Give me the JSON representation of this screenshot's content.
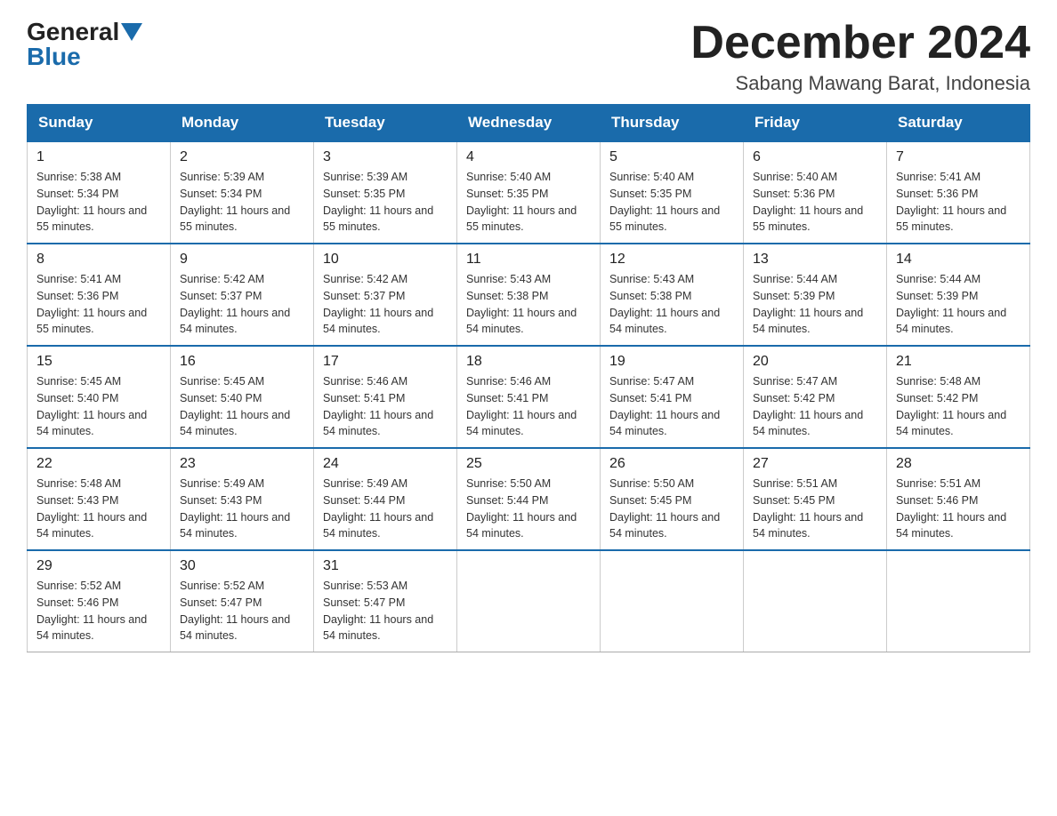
{
  "header": {
    "logo_general": "General",
    "logo_blue": "Blue",
    "month_title": "December 2024",
    "subtitle": "Sabang Mawang Barat, Indonesia"
  },
  "weekdays": [
    "Sunday",
    "Monday",
    "Tuesday",
    "Wednesday",
    "Thursday",
    "Friday",
    "Saturday"
  ],
  "weeks": [
    [
      {
        "day": "1",
        "sunrise": "5:38 AM",
        "sunset": "5:34 PM",
        "daylight": "11 hours and 55 minutes."
      },
      {
        "day": "2",
        "sunrise": "5:39 AM",
        "sunset": "5:34 PM",
        "daylight": "11 hours and 55 minutes."
      },
      {
        "day": "3",
        "sunrise": "5:39 AM",
        "sunset": "5:35 PM",
        "daylight": "11 hours and 55 minutes."
      },
      {
        "day": "4",
        "sunrise": "5:40 AM",
        "sunset": "5:35 PM",
        "daylight": "11 hours and 55 minutes."
      },
      {
        "day": "5",
        "sunrise": "5:40 AM",
        "sunset": "5:35 PM",
        "daylight": "11 hours and 55 minutes."
      },
      {
        "day": "6",
        "sunrise": "5:40 AM",
        "sunset": "5:36 PM",
        "daylight": "11 hours and 55 minutes."
      },
      {
        "day": "7",
        "sunrise": "5:41 AM",
        "sunset": "5:36 PM",
        "daylight": "11 hours and 55 minutes."
      }
    ],
    [
      {
        "day": "8",
        "sunrise": "5:41 AM",
        "sunset": "5:36 PM",
        "daylight": "11 hours and 55 minutes."
      },
      {
        "day": "9",
        "sunrise": "5:42 AM",
        "sunset": "5:37 PM",
        "daylight": "11 hours and 54 minutes."
      },
      {
        "day": "10",
        "sunrise": "5:42 AM",
        "sunset": "5:37 PM",
        "daylight": "11 hours and 54 minutes."
      },
      {
        "day": "11",
        "sunrise": "5:43 AM",
        "sunset": "5:38 PM",
        "daylight": "11 hours and 54 minutes."
      },
      {
        "day": "12",
        "sunrise": "5:43 AM",
        "sunset": "5:38 PM",
        "daylight": "11 hours and 54 minutes."
      },
      {
        "day": "13",
        "sunrise": "5:44 AM",
        "sunset": "5:39 PM",
        "daylight": "11 hours and 54 minutes."
      },
      {
        "day": "14",
        "sunrise": "5:44 AM",
        "sunset": "5:39 PM",
        "daylight": "11 hours and 54 minutes."
      }
    ],
    [
      {
        "day": "15",
        "sunrise": "5:45 AM",
        "sunset": "5:40 PM",
        "daylight": "11 hours and 54 minutes."
      },
      {
        "day": "16",
        "sunrise": "5:45 AM",
        "sunset": "5:40 PM",
        "daylight": "11 hours and 54 minutes."
      },
      {
        "day": "17",
        "sunrise": "5:46 AM",
        "sunset": "5:41 PM",
        "daylight": "11 hours and 54 minutes."
      },
      {
        "day": "18",
        "sunrise": "5:46 AM",
        "sunset": "5:41 PM",
        "daylight": "11 hours and 54 minutes."
      },
      {
        "day": "19",
        "sunrise": "5:47 AM",
        "sunset": "5:41 PM",
        "daylight": "11 hours and 54 minutes."
      },
      {
        "day": "20",
        "sunrise": "5:47 AM",
        "sunset": "5:42 PM",
        "daylight": "11 hours and 54 minutes."
      },
      {
        "day": "21",
        "sunrise": "5:48 AM",
        "sunset": "5:42 PM",
        "daylight": "11 hours and 54 minutes."
      }
    ],
    [
      {
        "day": "22",
        "sunrise": "5:48 AM",
        "sunset": "5:43 PM",
        "daylight": "11 hours and 54 minutes."
      },
      {
        "day": "23",
        "sunrise": "5:49 AM",
        "sunset": "5:43 PM",
        "daylight": "11 hours and 54 minutes."
      },
      {
        "day": "24",
        "sunrise": "5:49 AM",
        "sunset": "5:44 PM",
        "daylight": "11 hours and 54 minutes."
      },
      {
        "day": "25",
        "sunrise": "5:50 AM",
        "sunset": "5:44 PM",
        "daylight": "11 hours and 54 minutes."
      },
      {
        "day": "26",
        "sunrise": "5:50 AM",
        "sunset": "5:45 PM",
        "daylight": "11 hours and 54 minutes."
      },
      {
        "day": "27",
        "sunrise": "5:51 AM",
        "sunset": "5:45 PM",
        "daylight": "11 hours and 54 minutes."
      },
      {
        "day": "28",
        "sunrise": "5:51 AM",
        "sunset": "5:46 PM",
        "daylight": "11 hours and 54 minutes."
      }
    ],
    [
      {
        "day": "29",
        "sunrise": "5:52 AM",
        "sunset": "5:46 PM",
        "daylight": "11 hours and 54 minutes."
      },
      {
        "day": "30",
        "sunrise": "5:52 AM",
        "sunset": "5:47 PM",
        "daylight": "11 hours and 54 minutes."
      },
      {
        "day": "31",
        "sunrise": "5:53 AM",
        "sunset": "5:47 PM",
        "daylight": "11 hours and 54 minutes."
      },
      null,
      null,
      null,
      null
    ]
  ]
}
